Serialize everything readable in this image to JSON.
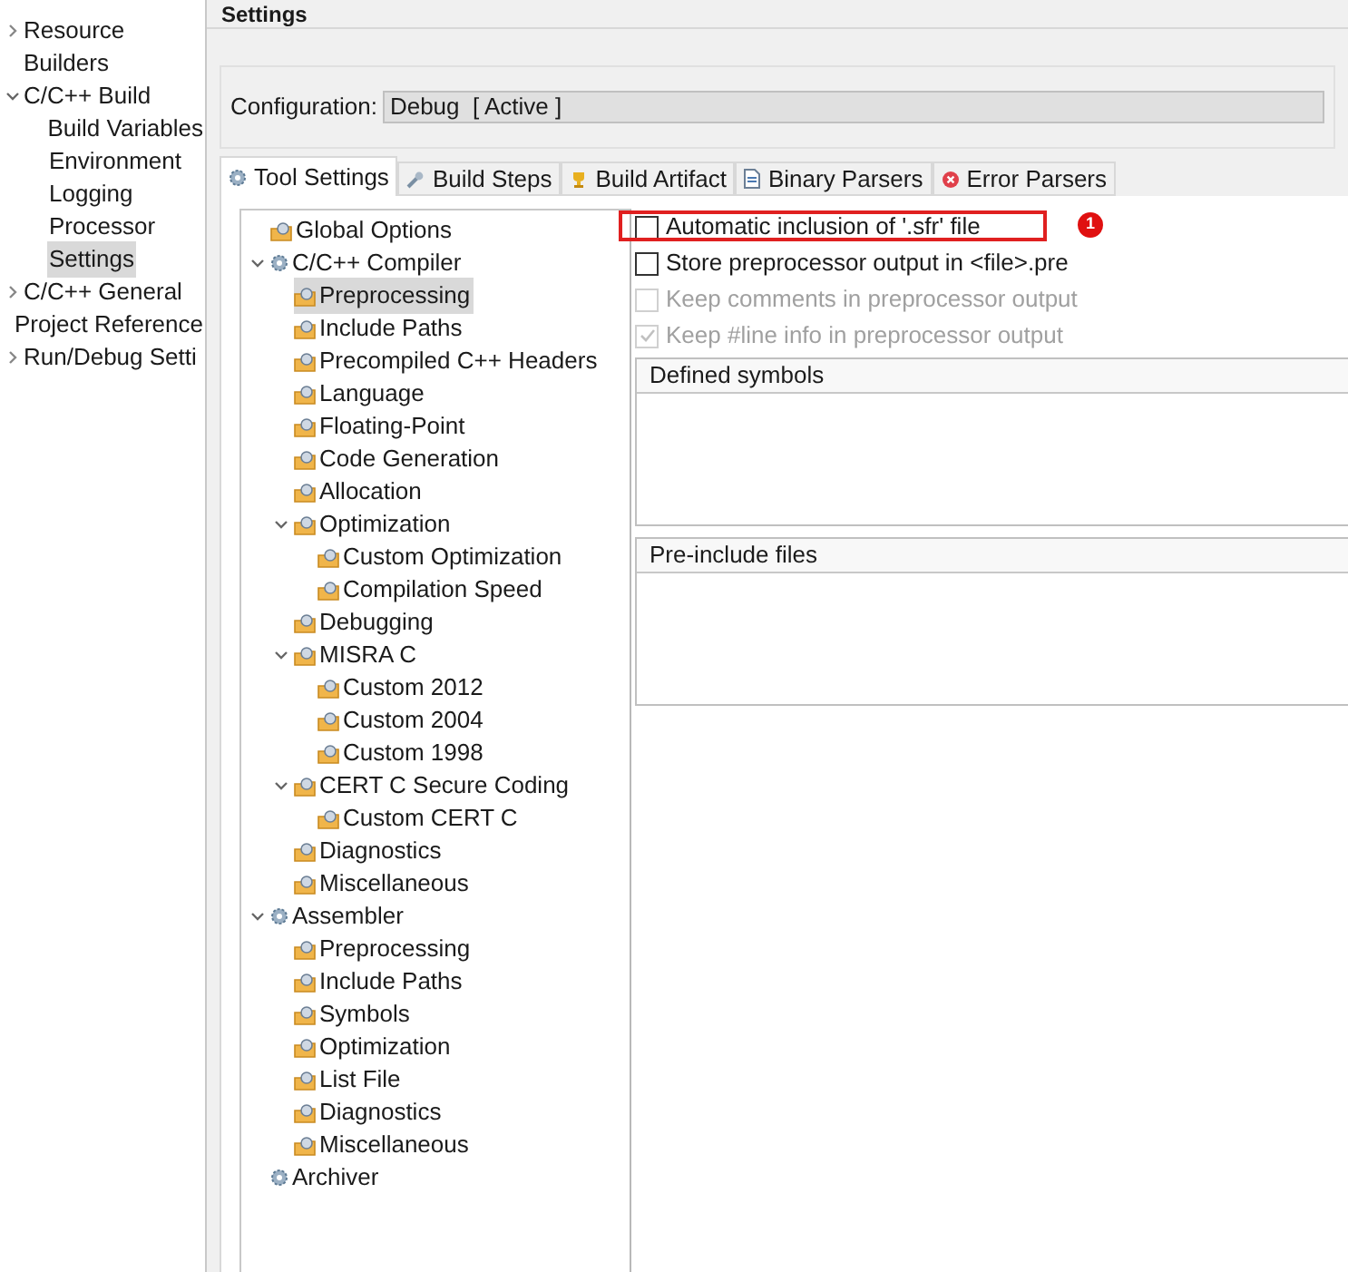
{
  "sidebar": {
    "items": [
      {
        "label": "Resource",
        "expanded": false,
        "selected": false
      },
      {
        "label": "Builders",
        "selected": false
      },
      {
        "label": "C/C++ Build",
        "expanded": true,
        "selected": false,
        "children": [
          {
            "label": "Build Variables",
            "selected": false
          },
          {
            "label": "Environment",
            "selected": false
          },
          {
            "label": "Logging",
            "selected": false
          },
          {
            "label": "Processor",
            "selected": false
          },
          {
            "label": "Settings",
            "selected": true
          }
        ]
      },
      {
        "label": "C/C++ General",
        "expanded": false,
        "selected": false
      },
      {
        "label": "Project Reference",
        "selected": false
      },
      {
        "label": "Run/Debug Setti",
        "expanded": false,
        "selected": false
      }
    ]
  },
  "page_title": "Settings",
  "configuration": {
    "label": "Configuration:",
    "value": "Debug  [ Active ]"
  },
  "tabs": [
    {
      "label": "Tool Settings",
      "kind": "tool",
      "selected": true
    },
    {
      "label": "Build Steps",
      "kind": "steps",
      "selected": false
    },
    {
      "label": "Build Artifact",
      "kind": "artifact",
      "selected": false
    },
    {
      "label": "Binary Parsers",
      "kind": "binary",
      "selected": false
    },
    {
      "label": "Error Parsers",
      "kind": "error",
      "selected": false
    }
  ],
  "tree": [
    {
      "label": "Global Options",
      "kind": "option",
      "selected": false
    },
    {
      "label": "C/C++ Compiler",
      "kind": "tool",
      "expanded": true,
      "selected": false,
      "children": [
        {
          "label": "Preprocessing",
          "kind": "option",
          "selected": true
        },
        {
          "label": "Include Paths",
          "kind": "option",
          "selected": false
        },
        {
          "label": "Precompiled C++ Headers",
          "kind": "option",
          "selected": false
        },
        {
          "label": "Language",
          "kind": "option",
          "selected": false
        },
        {
          "label": "Floating-Point",
          "kind": "option",
          "selected": false
        },
        {
          "label": "Code Generation",
          "kind": "option",
          "selected": false
        },
        {
          "label": "Allocation",
          "kind": "option",
          "selected": false
        },
        {
          "label": "Optimization",
          "kind": "option",
          "expanded": true,
          "selected": false,
          "children": [
            {
              "label": "Custom Optimization",
              "kind": "option",
              "selected": false
            },
            {
              "label": "Compilation Speed",
              "kind": "option",
              "selected": false
            }
          ]
        },
        {
          "label": "Debugging",
          "kind": "option",
          "selected": false
        },
        {
          "label": "MISRA C",
          "kind": "option",
          "expanded": true,
          "selected": false,
          "children": [
            {
              "label": "Custom 2012",
              "kind": "option",
              "selected": false
            },
            {
              "label": "Custom 2004",
              "kind": "option",
              "selected": false
            },
            {
              "label": "Custom 1998",
              "kind": "option",
              "selected": false
            }
          ]
        },
        {
          "label": "CERT C Secure Coding",
          "kind": "option",
          "expanded": true,
          "selected": false,
          "children": [
            {
              "label": "Custom CERT C",
              "kind": "option",
              "selected": false
            }
          ]
        },
        {
          "label": "Diagnostics",
          "kind": "option",
          "selected": false
        },
        {
          "label": "Miscellaneous",
          "kind": "option",
          "selected": false
        }
      ]
    },
    {
      "label": "Assembler",
      "kind": "tool",
      "expanded": true,
      "selected": false,
      "children": [
        {
          "label": "Preprocessing",
          "kind": "option",
          "selected": false
        },
        {
          "label": "Include Paths",
          "kind": "option",
          "selected": false
        },
        {
          "label": "Symbols",
          "kind": "option",
          "selected": false
        },
        {
          "label": "Optimization",
          "kind": "option",
          "selected": false
        },
        {
          "label": "List File",
          "kind": "option",
          "selected": false
        },
        {
          "label": "Diagnostics",
          "kind": "option",
          "selected": false
        },
        {
          "label": "Miscellaneous",
          "kind": "option",
          "selected": false
        }
      ]
    },
    {
      "label": "Archiver",
      "kind": "tool",
      "selected": false
    }
  ],
  "options": [
    {
      "label": "Automatic inclusion of '.sfr' file",
      "checked": false,
      "disabled": false,
      "highlighted": true,
      "badge": "1"
    },
    {
      "label": "Store preprocessor output in <file>.pre",
      "checked": false,
      "disabled": false,
      "highlighted": false
    },
    {
      "label": "Keep comments in preprocessor output",
      "checked": false,
      "disabled": true,
      "highlighted": false
    },
    {
      "label": "Keep #line info in preprocessor output",
      "checked": true,
      "disabled": true,
      "highlighted": false
    }
  ],
  "lists": [
    {
      "title": "Defined symbols"
    },
    {
      "title": "Pre-include files"
    }
  ]
}
